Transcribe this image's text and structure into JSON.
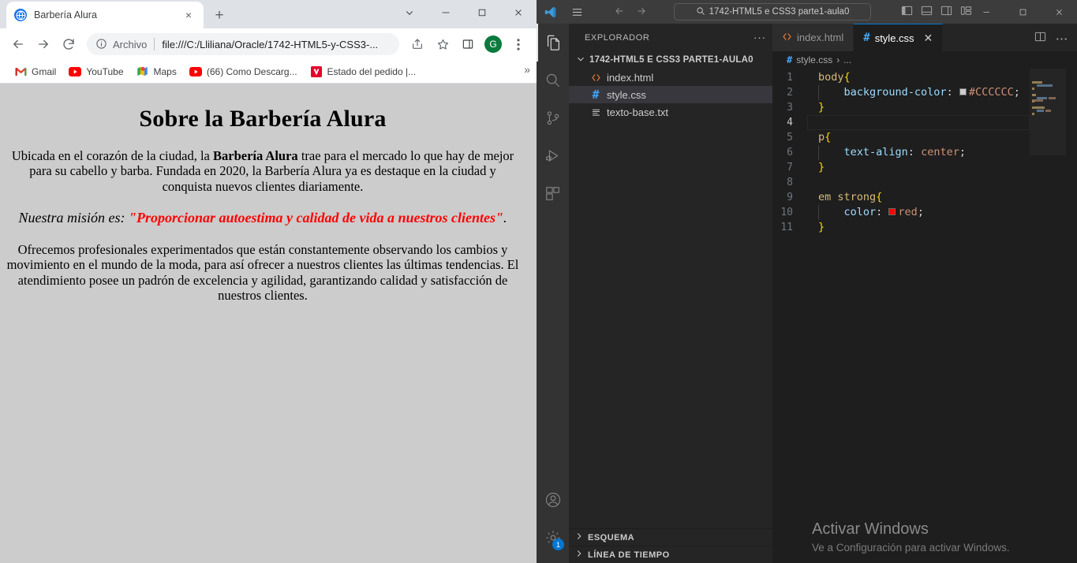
{
  "browser": {
    "tab": {
      "title": "Barbería Alura",
      "favicon": "globe-icon",
      "close": "×"
    },
    "new_tab_label": "+",
    "window_controls": {
      "more": "⌄",
      "minimize": "—",
      "maximize": "□",
      "close": "✕"
    },
    "toolbar": {
      "back": "←",
      "forward": "→",
      "reload": "⟳",
      "info_icon": "info-circle-icon",
      "scheme_label": "Archivo",
      "url": "file:///C:/Lliliana/Oracle/1742-HTML5-y-CSS3-...",
      "share_icon": "share-icon",
      "bookmark_icon": "star-icon",
      "sidepanel_icon": "side-panel-icon",
      "profile_initial": "G",
      "menu_icon": "kebab-menu-icon"
    },
    "bookmarks": [
      {
        "label": "Gmail",
        "icon": "gmail-icon"
      },
      {
        "label": "YouTube",
        "icon": "youtube-icon"
      },
      {
        "label": "Maps",
        "icon": "maps-icon"
      },
      {
        "label": "(66) Como Descarg...",
        "icon": "youtube-icon"
      },
      {
        "label": "Estado del pedido |...",
        "icon": "vivo-icon"
      }
    ],
    "bookmarks_overflow": "»",
    "page": {
      "heading": "Sobre la Barbería Alura",
      "p1_part1": "Ubicada en el corazón de la ciudad, la ",
      "p1_bold": "Barbería Alura",
      "p1_part2": " trae para el mercado lo que hay de mejor para su cabello y barba. Fundada en 2020, la Barbería Alura ya es destaque en la ciudad y conquista nuevos clientes diariamente.",
      "p2_lead": "Nuestra misión es: ",
      "p2_quote": "\"Proporcionar autoestima y calidad de vida a nuestros clientes\"",
      "p2_end": ".",
      "p3": "Ofrecemos profesionales experimentados que están constantemente observando los cambios y movimiento en el mundo de la moda, para así ofrecer a nuestros clientes las últimas tendencias. El atendimiento posee un padrón de excelencia y agilidad, garantizando calidad y satisfacción de nuestros clientes.",
      "background_color": "#CCCCCC",
      "accent_color": "#FF0000"
    }
  },
  "vscode": {
    "titlebar": {
      "logo": "vscode-logo-icon",
      "menu": "hamburger-menu-icon",
      "back": "←",
      "forward": "→",
      "quickinput_text": "1742-HTML5 e CSS3 parte1-aula0",
      "search_icon": "search-icon",
      "layout_icons": [
        "toggle-primary-sidebar-icon",
        "toggle-panel-icon",
        "toggle-secondary-sidebar-icon",
        "customize-layout-icon"
      ],
      "minimize": "—",
      "maximize": "□",
      "close": "✕"
    },
    "activitybar": {
      "items": [
        {
          "name": "explorer",
          "icon": "files-icon",
          "active": true
        },
        {
          "name": "search",
          "icon": "search-icon",
          "active": false
        },
        {
          "name": "source-control",
          "icon": "source-control-icon",
          "active": false
        },
        {
          "name": "run-and-debug",
          "icon": "run-debug-icon",
          "active": false
        },
        {
          "name": "extensions",
          "icon": "extensions-icon",
          "active": false
        }
      ],
      "account_icon": "account-icon",
      "settings_icon": "gear-icon",
      "settings_badge": "1"
    },
    "sidebar": {
      "title": "EXPLORADOR",
      "actions": "···",
      "root_folder": "1742-HTML5 E CSS3 PARTE1-AULA0",
      "root_chevron": "⌄",
      "files": [
        {
          "name": "index.html",
          "icon": "html-file-icon",
          "selected": false
        },
        {
          "name": "style.css",
          "icon": "css-file-icon",
          "selected": true
        },
        {
          "name": "texto-base.txt",
          "icon": "text-file-icon",
          "selected": false
        }
      ],
      "collapsed_sections": [
        {
          "label": "ESQUEMA",
          "chevron": "›"
        },
        {
          "label": "LÍNEA DE TIEMPO",
          "chevron": "›"
        }
      ]
    },
    "editor": {
      "tabs": [
        {
          "label": "index.html",
          "icon": "html-file-icon",
          "active": false,
          "close": ""
        },
        {
          "label": "style.css",
          "icon": "css-file-icon",
          "active": true,
          "close": "✕"
        }
      ],
      "tab_actions": [
        "split-editor-icon",
        "more-actions-icon"
      ],
      "breadcrumb": {
        "icon": "css-file-icon",
        "file": "style.css",
        "separator": "›",
        "rest": "..."
      },
      "active_line": 4,
      "lines": [
        {
          "n": "1",
          "tokens": [
            {
              "t": "body",
              "c": "sel"
            },
            {
              "t": "{",
              "c": "brace"
            }
          ],
          "indent": false
        },
        {
          "n": "2",
          "tokens": [
            {
              "t": "    ",
              "c": "punc"
            },
            {
              "t": "background-color",
              "c": "prop"
            },
            {
              "t": ": ",
              "c": "punc"
            },
            {
              "t": "SWATCH:#CCCCCC",
              "c": "swatch"
            },
            {
              "t": "#CCCCCC",
              "c": "val"
            },
            {
              "t": ";",
              "c": "punc"
            }
          ],
          "indent": true
        },
        {
          "n": "3",
          "tokens": [
            {
              "t": "}",
              "c": "brace"
            }
          ],
          "indent": false
        },
        {
          "n": "4",
          "tokens": [],
          "indent": false
        },
        {
          "n": "5",
          "tokens": [
            {
              "t": "p",
              "c": "sel"
            },
            {
              "t": "{",
              "c": "brace"
            }
          ],
          "indent": false
        },
        {
          "n": "6",
          "tokens": [
            {
              "t": "    ",
              "c": "punc"
            },
            {
              "t": "text-align",
              "c": "prop"
            },
            {
              "t": ": ",
              "c": "punc"
            },
            {
              "t": "center",
              "c": "val"
            },
            {
              "t": ";",
              "c": "punc"
            }
          ],
          "indent": true
        },
        {
          "n": "7",
          "tokens": [
            {
              "t": "}",
              "c": "brace"
            }
          ],
          "indent": false
        },
        {
          "n": "8",
          "tokens": [],
          "indent": false
        },
        {
          "n": "9",
          "tokens": [
            {
              "t": "em strong",
              "c": "sel"
            },
            {
              "t": "{",
              "c": "brace"
            }
          ],
          "indent": false
        },
        {
          "n": "10",
          "tokens": [
            {
              "t": "    ",
              "c": "punc"
            },
            {
              "t": "color",
              "c": "prop"
            },
            {
              "t": ": ",
              "c": "punc"
            },
            {
              "t": "SWATCH:#FF0000",
              "c": "swatch"
            },
            {
              "t": "red",
              "c": "val"
            },
            {
              "t": ";",
              "c": "punc"
            }
          ],
          "indent": true
        },
        {
          "n": "11",
          "tokens": [
            {
              "t": "}",
              "c": "brace"
            }
          ],
          "indent": false
        }
      ]
    },
    "watermark": {
      "title": "Activar Windows",
      "subtitle": "Ve a Configuración para activar Windows."
    }
  }
}
